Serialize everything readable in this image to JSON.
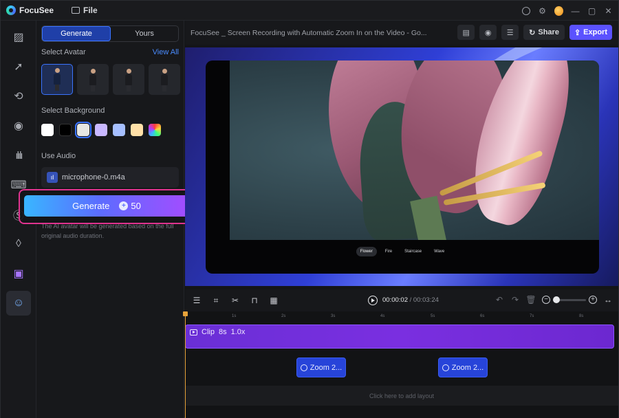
{
  "app": {
    "name": "FocuSee",
    "menu_file": "File"
  },
  "panel": {
    "tabs": [
      "Generate",
      "Yours"
    ],
    "select_avatar": "Select Avatar",
    "view_all": "View All",
    "select_background": "Select Background",
    "backgrounds": [
      "#ffffff",
      "#000000",
      "#e6e7e2",
      "#c9b8ff",
      "#a6bfff",
      "#ffe0a8",
      "rainbow"
    ],
    "use_audio": "Use Audio",
    "audio_file": "microphone-0.m4a",
    "generate_label": "Generate",
    "generate_cost": "50",
    "note": "The AI avatar will be generated based on the full original audio duration."
  },
  "editor": {
    "doc_title": "FocuSee _ Screen Recording with Automatic Zoom In on the Video - Go...",
    "share_label": "Share",
    "export_label": "Export"
  },
  "preview": {
    "effects": [
      "Flower",
      "Fire",
      "Staircase",
      "Wave"
    ],
    "active_effect": "Flower"
  },
  "playback": {
    "current_time": "00:00:02",
    "total_time": "00:03:24"
  },
  "timeline": {
    "ticks": [
      "1s",
      "2s",
      "3s",
      "4s",
      "5s",
      "6s",
      "7s",
      "8s"
    ],
    "clip_label": "Clip",
    "clip_duration": "8s",
    "clip_speed": "1.0x",
    "zoom_blocks": [
      "Zoom  2...",
      "Zoom  2..."
    ],
    "layout_hint": "Click here to add layout"
  },
  "colors": {
    "accent": "#3a74ff",
    "export": "#5b52ff",
    "clip": "#7a2fe0",
    "zoom": "#2744d9",
    "highlight": "#e0338f"
  }
}
